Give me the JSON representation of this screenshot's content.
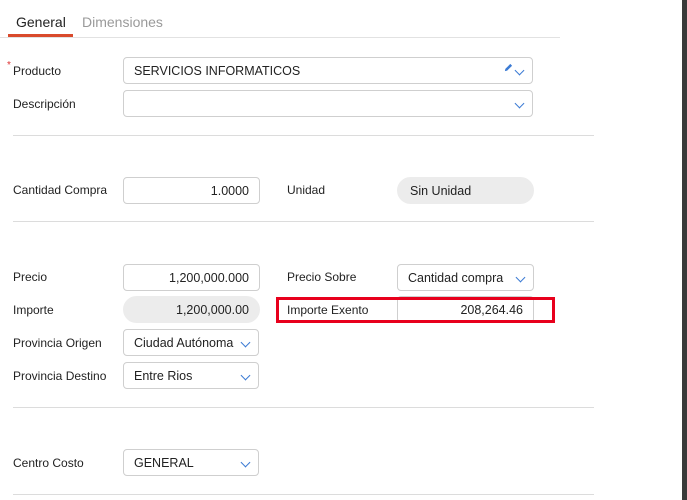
{
  "tabs": [
    {
      "label": "General",
      "active": true
    },
    {
      "label": "Dimensiones",
      "active": false
    }
  ],
  "fields": {
    "producto": {
      "label": "Producto",
      "value": "SERVICIOS INFORMATICOS"
    },
    "descripcion": {
      "label": "Descripción",
      "value": ""
    },
    "cantidad_compra": {
      "label": "Cantidad Compra",
      "value": "1.0000"
    },
    "unidad": {
      "label": "Unidad",
      "value": "Sin Unidad"
    },
    "precio": {
      "label": "Precio",
      "value": "1,200,000.000"
    },
    "precio_sobre": {
      "label": "Precio Sobre",
      "value": "Cantidad compra"
    },
    "importe": {
      "label": "Importe",
      "value": "1,200,000.00"
    },
    "importe_exento": {
      "label": "Importe Exento",
      "value": "208,264.46"
    },
    "provincia_origen": {
      "label": "Provincia Origen",
      "value": "Ciudad Autónoma"
    },
    "provincia_destino": {
      "label": "Provincia Destino",
      "value": "Entre Rios"
    },
    "centro_costo": {
      "label": "Centro Costo",
      "value": "GENERAL"
    }
  },
  "colors": {
    "accent": "#d94a2c",
    "icon": "#3c7bd4",
    "highlight": "#e8001c",
    "required": "#dd3333"
  }
}
